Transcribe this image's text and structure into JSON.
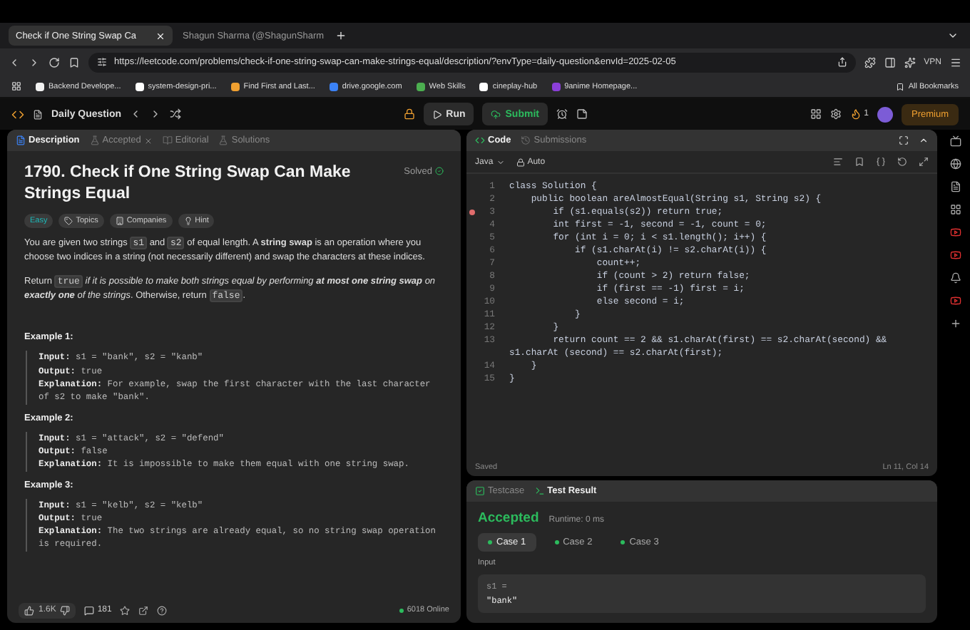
{
  "browser": {
    "tabs": [
      {
        "label": "Check if One String Swap Ca",
        "selected": true
      },
      {
        "label": "Shagun Sharma (@ShagunSharm",
        "selected": false
      }
    ],
    "url": "https://leetcode.com/problems/check-if-one-string-swap-can-make-strings-equal/description/?envType=daily-question&envId=2025-02-05",
    "vpn": "VPN",
    "bookmarks": [
      {
        "label": "Backend Develope...",
        "color": "#f2f2f2"
      },
      {
        "label": "system-design-pri...",
        "color": "#ffffff"
      },
      {
        "label": "Find First and Last...",
        "color": "#f0a030"
      },
      {
        "label": "drive.google.com",
        "color": "#3b82f6"
      },
      {
        "label": "Web Skills",
        "color": "#4caf50"
      },
      {
        "label": "cineplay-hub",
        "color": "#ffffff"
      },
      {
        "label": "9anime Homepage...",
        "color": "#8b3fd9"
      }
    ],
    "all_bookmarks": "All Bookmarks"
  },
  "app_header": {
    "title": "Daily Question",
    "run": "Run",
    "submit": "Submit",
    "streak": "1",
    "premium": "Premium"
  },
  "description_panel": {
    "tabs": [
      {
        "label": "Description",
        "selected": true,
        "closable": false
      },
      {
        "label": "Accepted",
        "selected": false,
        "closable": true
      },
      {
        "label": "Editorial",
        "selected": false,
        "closable": false
      },
      {
        "label": "Solutions",
        "selected": false,
        "closable": false
      }
    ],
    "title": "1790. Check if One String Swap Can Make Strings Equal",
    "status": "Solved",
    "tags": [
      {
        "kind": "difficulty",
        "label": "Easy"
      },
      {
        "kind": "topics",
        "label": "Topics"
      },
      {
        "kind": "companies",
        "label": "Companies"
      },
      {
        "kind": "hint",
        "label": "Hint"
      }
    ],
    "paragraphs": [
      [
        {
          "kind": "plain",
          "text": "You are given two strings "
        },
        {
          "kind": "code",
          "text": "s1"
        },
        {
          "kind": "plain",
          "text": " and "
        },
        {
          "kind": "code",
          "text": "s2"
        },
        {
          "kind": "plain",
          "text": " of equal length. A "
        },
        {
          "kind": "bold",
          "text": "string swap"
        },
        {
          "kind": "plain",
          "text": " is an operation where you choose two indices in a string (not necessarily different) and swap the characters at these indices."
        }
      ],
      [
        {
          "kind": "plain",
          "text": "Return "
        },
        {
          "kind": "code",
          "text": "true"
        },
        {
          "kind": "italic",
          "text": " if it is possible to make both strings equal by performing "
        },
        {
          "kind": "bolditalic",
          "text": "at most one string swap"
        },
        {
          "kind": "italic",
          "text": " on "
        },
        {
          "kind": "bolditalic",
          "text": "exactly one"
        },
        {
          "kind": "italic",
          "text": " of the strings"
        },
        {
          "kind": "plain",
          "text": ". Otherwise, return "
        },
        {
          "kind": "code",
          "text": "false"
        },
        {
          "kind": "plain",
          "text": "."
        }
      ]
    ],
    "examples": [
      {
        "heading": "Example 1:",
        "lines": [
          "**Input:** s1 = \"bank\", s2 = \"kanb\"",
          "**Output:** true",
          "**Explanation:** For example, swap the first character with the last character of s2 to make \"bank\"."
        ]
      },
      {
        "heading": "Example 2:",
        "lines": [
          "**Input:** s1 = \"attack\", s2 = \"defend\"",
          "**Output:** false",
          "**Explanation:** It is impossible to make them equal with one string swap."
        ]
      },
      {
        "heading": "Example 3:",
        "lines": [
          "**Input:** s1 = \"kelb\", s2 = \"kelb\"",
          "**Output:** true",
          "**Explanation:** The two strings are already equal, so no string swap operation is required."
        ]
      }
    ],
    "likes": "1.6K",
    "comments": "181",
    "online": "6018 Online"
  },
  "code_panel": {
    "tabs": [
      {
        "label": "Code",
        "selected": true
      },
      {
        "label": "Submissions",
        "selected": false
      }
    ],
    "language": "Java",
    "mode": "Auto",
    "lines": [
      {
        "no": "1",
        "text": "class Solution {",
        "breakpoint": false
      },
      {
        "no": "2",
        "text": "    public boolean areAlmostEqual(String s1, String s2) {",
        "breakpoint": false
      },
      {
        "no": "3",
        "text": "        if (s1.equals(s2)) return true;",
        "breakpoint": true
      },
      {
        "no": "4",
        "text": "        int first = -1, second = -1, count = 0;",
        "breakpoint": false
      },
      {
        "no": "5",
        "text": "        for (int i = 0; i < s1.length(); i++) {",
        "breakpoint": false
      },
      {
        "no": "6",
        "text": "            if (s1.charAt(i) != s2.charAt(i)) {",
        "breakpoint": false
      },
      {
        "no": "7",
        "text": "                count++;",
        "breakpoint": false
      },
      {
        "no": "8",
        "text": "                if (count > 2) return false;",
        "breakpoint": false
      },
      {
        "no": "9",
        "text": "                if (first == -1) first = i;",
        "breakpoint": false
      },
      {
        "no": "10",
        "text": "                else second = i;",
        "breakpoint": false
      },
      {
        "no": "11",
        "text": "            }",
        "breakpoint": false
      },
      {
        "no": "12",
        "text": "        }",
        "breakpoint": false
      },
      {
        "no": "13",
        "text": "        return count == 2 && s1.charAt(first) == s2.charAt(second) && s1.charAt (second) == s2.charAt(first);",
        "breakpoint": false
      },
      {
        "no": "14",
        "text": "    }",
        "breakpoint": false
      },
      {
        "no": "15",
        "text": "}",
        "breakpoint": false
      }
    ],
    "saved": "Saved",
    "cursor": "Ln 11, Col 14"
  },
  "result_panel": {
    "tabs": [
      {
        "label": "Testcase",
        "selected": false
      },
      {
        "label": "Test Result",
        "selected": true
      }
    ],
    "verdict": "Accepted",
    "runtime": "Runtime: 0 ms",
    "cases": [
      {
        "label": "Case 1",
        "selected": true
      },
      {
        "label": "Case 2",
        "selected": false
      },
      {
        "label": "Case 3",
        "selected": false
      }
    ],
    "input_label": "Input",
    "var": "s1 =",
    "value": "\"bank\""
  }
}
